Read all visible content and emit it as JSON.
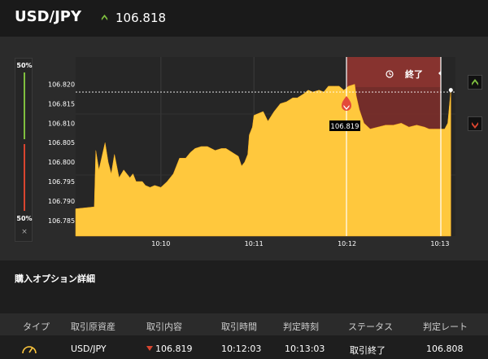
{
  "header": {
    "pair": "USD/JPY",
    "price": "106.818",
    "trend_icon": "up-arrow-icon",
    "accent_green": "#7fbf3f"
  },
  "ratio": {
    "top_label": "50%",
    "bottom_label": "50%",
    "close_glyph": "×",
    "up_percent": 50,
    "down_percent": 50
  },
  "chart_data": {
    "type": "area",
    "x_tick_labels": [
      "10:10",
      "10:11",
      "10:12",
      "10:13"
    ],
    "y_tick_labels": [
      "106.820",
      "106.815",
      "106.810",
      "106.805",
      "106.800",
      "106.795",
      "106.790",
      "106.785"
    ],
    "ylim": [
      106.781,
      106.827
    ],
    "x_range_seconds": [
      555,
      800
    ],
    "grid": true,
    "fill_color": "#ffc83d",
    "current_price": 106.818,
    "end_label": "終了",
    "entry": {
      "time": "10:12:03",
      "price": 106.819,
      "label": "106.819"
    },
    "series": [
      {
        "values": [
          [
            555,
            106.788
          ],
          [
            567,
            106.7885
          ],
          [
            568,
            106.803
          ],
          [
            570,
            106.798
          ],
          [
            574,
            106.805
          ],
          [
            576,
            106.8
          ],
          [
            578,
            106.797
          ],
          [
            580,
            106.802
          ],
          [
            583,
            106.796
          ],
          [
            586,
            106.798
          ],
          [
            588,
            106.797
          ],
          [
            590,
            106.796
          ],
          [
            592,
            106.797
          ],
          [
            594,
            106.795
          ],
          [
            598,
            106.795
          ],
          [
            600,
            106.794
          ],
          [
            603,
            106.7935
          ],
          [
            606,
            106.794
          ],
          [
            610,
            106.7935
          ],
          [
            614,
            106.795
          ],
          [
            618,
            106.797
          ],
          [
            622,
            106.801
          ],
          [
            626,
            106.801
          ],
          [
            629,
            106.8025
          ],
          [
            632,
            106.8035
          ],
          [
            636,
            106.804
          ],
          [
            640,
            106.804
          ],
          [
            645,
            106.803
          ],
          [
            649,
            106.8035
          ],
          [
            652,
            106.8035
          ],
          [
            656,
            106.8025
          ],
          [
            660,
            106.8015
          ],
          [
            662,
            106.799
          ],
          [
            664,
            106.8
          ],
          [
            666,
            106.802
          ],
          [
            667,
            106.807
          ],
          [
            669,
            106.809
          ],
          [
            670,
            106.812
          ],
          [
            673,
            106.8125
          ],
          [
            676,
            106.813
          ],
          [
            679,
            106.8105
          ],
          [
            683,
            106.813
          ],
          [
            687,
            106.815
          ],
          [
            691,
            106.8155
          ],
          [
            695,
            106.8165
          ],
          [
            698,
            106.8165
          ],
          [
            702,
            106.8175
          ],
          [
            705,
            106.8185
          ],
          [
            708,
            106.818
          ],
          [
            712,
            106.8185
          ],
          [
            715,
            106.818
          ],
          [
            718,
            106.8195
          ],
          [
            722,
            106.8195
          ],
          [
            725,
            106.8195
          ],
          [
            728,
            106.8185
          ],
          [
            731,
            106.8195
          ],
          [
            735,
            106.82
          ],
          [
            736,
            106.817
          ],
          [
            738,
            106.8135
          ],
          [
            741,
            106.81
          ],
          [
            745,
            106.8085
          ],
          [
            750,
            106.809
          ],
          [
            755,
            106.8095
          ],
          [
            760,
            106.8095
          ],
          [
            765,
            106.81
          ],
          [
            770,
            106.809
          ],
          [
            775,
            106.8095
          ],
          [
            780,
            106.809
          ],
          [
            783,
            106.8085
          ],
          [
            786,
            106.8085
          ],
          [
            790,
            106.8085
          ],
          [
            793,
            106.8085
          ],
          [
            795,
            106.81
          ],
          [
            797,
            106.8185
          ]
        ]
      }
    ]
  },
  "side_buttons": {
    "up_icon": "chevron-up-icon",
    "down_icon": "chevron-down-icon",
    "up_color": "#7fbf3f",
    "down_color": "#d9452f"
  },
  "section": {
    "title": "購入オプション詳細"
  },
  "table": {
    "columns": [
      "タイプ",
      "取引原資産",
      "取引内容",
      "取引時間",
      "判定時刻",
      "ステータス",
      "判定レート"
    ],
    "row": {
      "type_icon": "gauge-icon",
      "asset": "USD/JPY",
      "direction_icon": "down-arrow-icon",
      "content": "106.819",
      "trade_time": "10:12:03",
      "judge_time": "10:13:03",
      "status": "取引終了",
      "judge_rate": "106.808"
    }
  }
}
